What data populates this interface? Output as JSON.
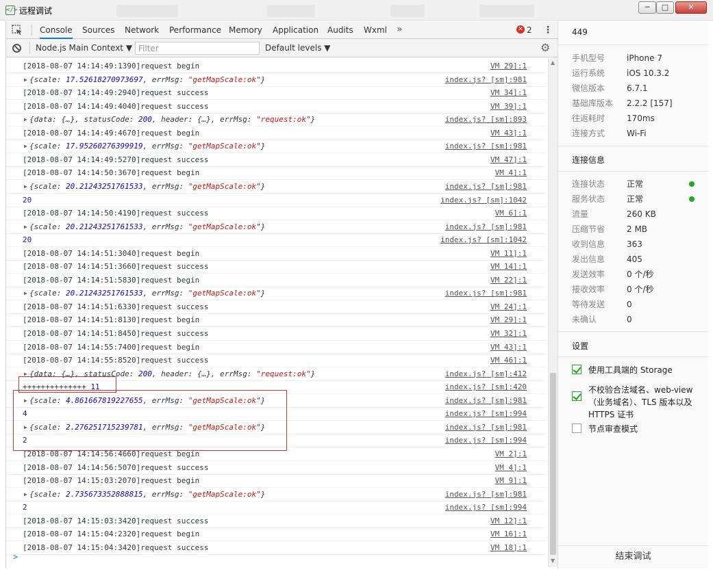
{
  "window": {
    "title": "远程调试"
  },
  "tabs": [
    "Console",
    "Sources",
    "Network",
    "Performance",
    "Memory",
    "Application",
    "Audits",
    "Wxml"
  ],
  "error_count": "2",
  "toolbar": {
    "context": "Node.js Main Context",
    "filter_placeholder": "Filter",
    "levels": "Default levels"
  },
  "console_rows": [
    {
      "ts": "[2018-08-07 14:14:49:1390]",
      "text": "request begin",
      "src": "VM 29]:1"
    },
    {
      "scale": "17.52618270973697",
      "map_msg": "\"getMapScale:ok\"",
      "src": "index.js? [sm]:981"
    },
    {
      "ts": "[2018-08-07 14:14:49:2940]",
      "text": "request success",
      "src": "VM 34]:1"
    },
    {
      "ts": "[2018-08-07 14:14:49:4040]",
      "text": "request success",
      "src": "VM 39]:1"
    },
    {
      "status": "200",
      "req_msg": "\"request:ok\"",
      "src": "index.js? [sm]:893"
    },
    {
      "ts": "[2018-08-07 14:14:49:4670]",
      "text": "request begin",
      "src": "VM 43]:1"
    },
    {
      "scale": "17.95260276399919",
      "map_msg": "\"getMapScale:ok\"",
      "src": "index.js? [sm]:981"
    },
    {
      "ts": "[2018-08-07 14:14:49:5270]",
      "text": "request success",
      "src": "VM 47]:1"
    },
    {
      "ts": "[2018-08-07 14:14:50:3670]",
      "text": "request begin",
      "src": "VM 4]:1"
    },
    {
      "scale": "20.21243251761533",
      "map_msg": "\"getMapScale:ok\"",
      "src": "index.js? [sm]:981"
    },
    {
      "num": "20",
      "src": "index.js? [sm]:1042"
    },
    {
      "ts": "[2018-08-07 14:14:50:4190]",
      "text": "request success",
      "src": "VM 6]:1"
    },
    {
      "scale": "20.21243251761533",
      "map_msg": "\"getMapScale:ok\"",
      "src": "index.js? [sm]:981"
    },
    {
      "num": "20",
      "src": "index.js? [sm]:1042"
    },
    {
      "ts": "[2018-08-07 14:14:51:3040]",
      "text": "request begin",
      "src": "VM 11]:1"
    },
    {
      "ts": "[2018-08-07 14:14:51:3660]",
      "text": "request success",
      "src": "VM 14]:1"
    },
    {
      "ts": "[2018-08-07 14:14:51:5830]",
      "text": "request begin",
      "src": "VM 22]:1"
    },
    {
      "scale": "20.21243251761533",
      "map_msg": "\"getMapScale:ok\"",
      "src": "index.js? [sm]:981"
    },
    {
      "ts": "[2018-08-07 14:14:51:6330]",
      "text": "request success",
      "src": "VM 24]:1"
    },
    {
      "ts": "[2018-08-07 14:14:51:8130]",
      "text": "request begin",
      "src": "VM 29]:1"
    },
    {
      "ts": "[2018-08-07 14:14:51:8450]",
      "text": "request success",
      "src": "VM 32]:1"
    },
    {
      "ts": "[2018-08-07 14:14:55:7400]",
      "text": "request begin",
      "src": "VM 43]:1"
    },
    {
      "ts": "[2018-08-07 14:14:55:8520]",
      "text": "request success",
      "src": "VM 46]:1"
    },
    {
      "status": "200",
      "req_msg": "\"request:ok\"",
      "src": "index.js? [sm]:412"
    },
    {
      "plain": "++++++++++++++",
      "num": "11",
      "src": "index.js? [sm]:420"
    },
    {
      "scale": "4.861667819227655",
      "map_msg": "\"getMapScale:ok\"",
      "src": "index.js? [sm]:981"
    },
    {
      "num": "4",
      "src": "index.js? [sm]:994"
    },
    {
      "scale": "2.276251715239781",
      "map_msg": "\"getMapScale:ok\"",
      "src": "index.js? [sm]:981"
    },
    {
      "num": "2",
      "src": "index.js? [sm]:994"
    },
    {
      "ts": "[2018-08-07 14:14:56:4660]",
      "text": "request begin",
      "src": "VM 2]:1"
    },
    {
      "ts": "[2018-08-07 14:14:56:5070]",
      "text": "request success",
      "src": "VM 4]:1"
    },
    {
      "ts": "[2018-08-07 14:15:03:2070]",
      "text": "request begin",
      "src": "VM 9]:1"
    },
    {
      "scale": "2.735673352888815",
      "map_msg": "\"getMapScale:ok\"",
      "src": "index.js? [sm]:981"
    },
    {
      "num": "2",
      "src": "index.js? [sm]:994"
    },
    {
      "ts": "[2018-08-07 14:15:03:3420]",
      "text": "request success",
      "src": "VM 12]:1"
    },
    {
      "ts": "[2018-08-07 14:15:04:2320]",
      "text": "request begin",
      "src": "VM 16]:1"
    },
    {
      "ts": "[2018-08-07 14:15:04:3420]",
      "text": "request success",
      "src": "VM 18]:1"
    }
  ],
  "console_prompt": ">",
  "right_panel": {
    "top_value": "449",
    "device_info": [
      {
        "label": "手机型号",
        "value": "iPhone 7"
      },
      {
        "label": "运行系统",
        "value": "iOS 10.3.2"
      },
      {
        "label": "微信版本",
        "value": "6.7.1"
      },
      {
        "label": "基础库版本",
        "value": "2.2.2 [157]"
      },
      {
        "label": "往返耗时",
        "value": "170ms"
      },
      {
        "label": "连接方式",
        "value": "Wi-Fi"
      }
    ],
    "connection_title": "连接信息",
    "connection_info": [
      {
        "label": "连接状态",
        "value": "正常",
        "status_dot": true
      },
      {
        "label": "服务状态",
        "value": "正常",
        "status_dot": true
      },
      {
        "label": "流量",
        "value": "260 KB"
      },
      {
        "label": "压缩节省",
        "value": "2 MB"
      },
      {
        "label": "收到信息",
        "value": "363"
      },
      {
        "label": "发出信息",
        "value": "405"
      },
      {
        "label": "发送效率",
        "value": "0 个/秒"
      },
      {
        "label": "接收效率",
        "value": "0 个/秒"
      },
      {
        "label": "等待发送",
        "value": "0"
      },
      {
        "label": "未确认",
        "value": "0"
      }
    ],
    "settings_title": "设置",
    "settings": [
      {
        "label": "使用工具端的 Storage",
        "checked": true
      },
      {
        "label": "不校验合法域名、web-view（业务域名）、TLS 版本以及 HTTPS 证书",
        "checked": true
      },
      {
        "label": "节点审查模式",
        "checked": false
      }
    ],
    "end_button": "结束调试"
  },
  "colors": {
    "accent": "#1a73e8",
    "ok_dot": "#1aad19",
    "highlight": "#d0342c",
    "number": "#1c00cf",
    "string": "#c41a16"
  }
}
